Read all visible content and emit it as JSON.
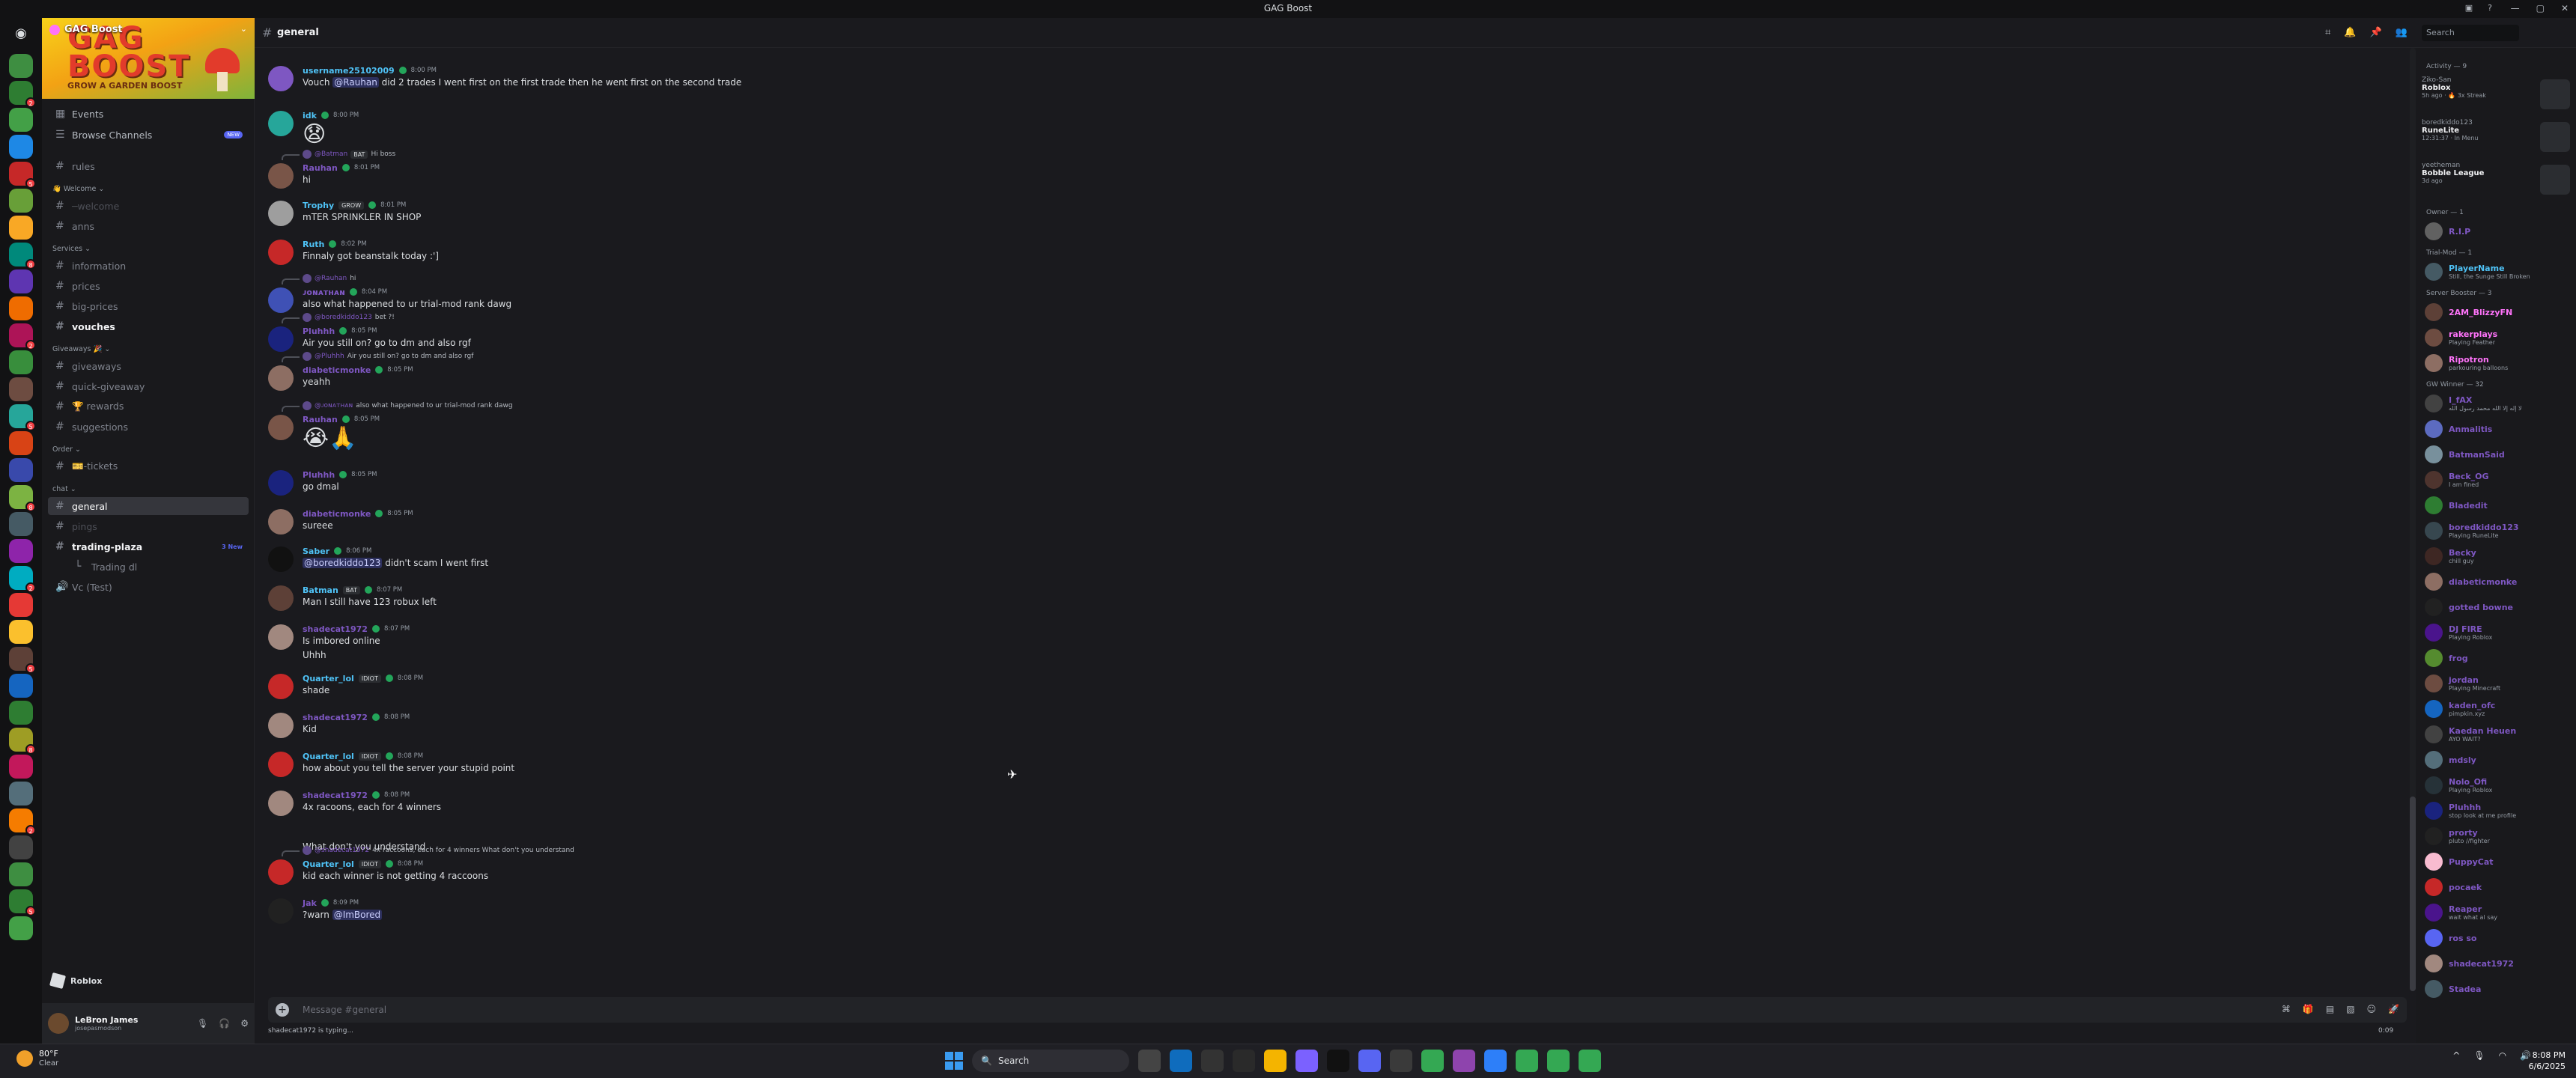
{
  "window": {
    "title": "GAG Boost"
  },
  "server": {
    "name": "GAG Boost",
    "banner_word": "GAG BOOST",
    "banner_sub": "GROW A GARDEN BOOST"
  },
  "sidebar": {
    "top_items": [
      {
        "label": "Events"
      },
      {
        "label": "Browse Channels",
        "tag": "NEW"
      }
    ],
    "rows": [
      {
        "kind": "channel",
        "label": "rules",
        "style": "normal"
      },
      {
        "kind": "category",
        "label": "👋 Welcome ⌄"
      },
      {
        "kind": "channel",
        "label": "─welcome",
        "style": "dim"
      },
      {
        "kind": "channel",
        "label": "anns",
        "style": "normal"
      },
      {
        "kind": "category",
        "label": "Services ⌄"
      },
      {
        "kind": "channel",
        "label": "information",
        "style": "normal"
      },
      {
        "kind": "channel",
        "label": "prices",
        "style": "normal"
      },
      {
        "kind": "channel",
        "label": "big-prices",
        "style": "normal"
      },
      {
        "kind": "channel",
        "label": "vouches",
        "style": "bright"
      },
      {
        "kind": "category",
        "label": "Giveaways 🎉 ⌄"
      },
      {
        "kind": "channel",
        "label": "giveaways",
        "style": "normal"
      },
      {
        "kind": "channel",
        "label": "quick-giveaway",
        "style": "normal"
      },
      {
        "kind": "channel",
        "label": "🏆 rewards",
        "style": "normal"
      },
      {
        "kind": "channel",
        "label": "suggestions",
        "style": "normal"
      },
      {
        "kind": "category",
        "label": "Order ⌄"
      },
      {
        "kind": "channel",
        "label": "🎫-tickets",
        "style": "normal"
      },
      {
        "kind": "category",
        "label": "chat ⌄"
      },
      {
        "kind": "channel",
        "label": "general",
        "style": "active"
      },
      {
        "kind": "channel",
        "label": "pings",
        "style": "dim"
      },
      {
        "kind": "channel",
        "label": "trading-plaza",
        "style": "bright",
        "extra": "3 New"
      },
      {
        "kind": "thread",
        "label": "Trading dl",
        "style": "normal"
      },
      {
        "kind": "voice",
        "label": "Vc (Test)",
        "style": "normal"
      }
    ]
  },
  "activity_bar": {
    "label": "Roblox"
  },
  "user": {
    "name": "LeBron James",
    "status": "josepasmodson"
  },
  "header": {
    "channel": "general",
    "search_placeholder": "Search"
  },
  "messages": [
    {
      "user": "username25102009",
      "color": "#4fc3f7",
      "time": "8:00 PM",
      "text_pre": "Vouch ",
      "mention": "@Rauhan",
      "text_post": " did 2 trades I went first on the first trade then he went first on the second trade",
      "avatar": "#7e57c2"
    },
    {
      "user": "idk",
      "color": "#4fc3f7",
      "time": "8:00 PM",
      "emoji": "😧",
      "avatar": "#26a69a"
    },
    {
      "user": "Rauhan",
      "color": "#7e57c2",
      "time": "8:01 PM",
      "text_pre": "hi",
      "reply_name": "@Batman",
      "reply_tag": "BAT",
      "reply_text": "Hi boss",
      "avatar": "#795548"
    },
    {
      "user": "Trophy",
      "color": "#4fc3f7",
      "tag": "GROW",
      "time": "8:01 PM",
      "text_pre": "mTER SPRINKLER IN SHOP",
      "avatar": "#9e9e9e"
    },
    {
      "user": "Ruth",
      "color": "#4fc3f7",
      "time": "8:02 PM",
      "text_pre": "Finnaly got beanstalk today :']",
      "avatar": "#c62828"
    },
    {
      "user": "ᴊᴏɴᴀᴛʜᴀɴ",
      "color": "#7e57c2",
      "time": "8:04 PM",
      "text_pre": "also what happened to ur trial-mod rank dawg",
      "reply_name": "@Rauhan",
      "reply_text": "hi",
      "avatar": "#3f51b5"
    },
    {
      "user": "Pluhhh",
      "color": "#7e57c2",
      "time": "8:05 PM",
      "text_pre": "Air you still on? go to dm and also rgf",
      "reply_name": "@boredkiddo123",
      "reply_text": "bet ?!",
      "avatar": "#1a237e"
    },
    {
      "user": "diabeticmonke",
      "color": "#7e57c2",
      "time": "8:05 PM",
      "text_pre": "yeahh",
      "reply_name": "@Pluhhh",
      "reply_text": "Air you still on? go to dm and also rgf",
      "avatar": "#8d6e63"
    },
    {
      "user": "Rauhan",
      "color": "#7e57c2",
      "time": "8:05 PM",
      "emoji": "😭🙏",
      "reply_name": "@ᴊᴏɴᴀᴛʜᴀɴ",
      "reply_text": "also what happened to ur trial-mod rank dawg",
      "avatar": "#795548"
    },
    {
      "user": "Pluhhh",
      "color": "#7e57c2",
      "time": "8:05 PM",
      "text_pre": "go dmal",
      "avatar": "#1a237e"
    },
    {
      "user": "diabeticmonke",
      "color": "#7e57c2",
      "time": "8:05 PM",
      "text_pre": "sureee",
      "avatar": "#8d6e63"
    },
    {
      "user": "Saber",
      "color": "#4fc3f7",
      "time": "8:06 PM",
      "mention_first": "@boredkiddo123",
      "text_post": " didn't scam I went first",
      "avatar": "#111111"
    },
    {
      "user": "Batman",
      "color": "#4fc3f7",
      "tag": "BAT",
      "time": "8:07 PM",
      "text_pre": "Man I still have 123 robux left",
      "avatar": "#5d4037"
    },
    {
      "user": "shadecat1972",
      "color": "#7e57c2",
      "time": "8:07 PM",
      "text_pre": "Is imbored online",
      "text_line2": "Uhhh",
      "avatar": "#a1887f"
    },
    {
      "user": "Quarter_lol",
      "color": "#4fc3f7",
      "tag": "IDIOT",
      "time": "8:08 PM",
      "text_pre": "shade",
      "avatar": "#c62828"
    },
    {
      "user": "shadecat1972",
      "color": "#7e57c2",
      "time": "8:08 PM",
      "text_pre": "Kid",
      "avatar": "#a1887f"
    },
    {
      "user": "Quarter_lol",
      "color": "#4fc3f7",
      "tag": "IDIOT",
      "time": "8:08 PM",
      "text_pre": "how about you tell the server your stupid point",
      "avatar": "#c62828"
    },
    {
      "user": "shadecat1972",
      "color": "#7e57c2",
      "time": "8:08 PM",
      "text_pre": "4x racoons, each for 4 winners",
      "text_line3": "What don't you understand",
      "avatar": "#a1887f"
    },
    {
      "user": "Quarter_lol",
      "color": "#4fc3f7",
      "tag": "IDIOT",
      "time": "8:08 PM",
      "text_pre": "kid each winner is not getting 4 raccoons",
      "reply_name": "@shadecat1972",
      "reply_text": "4x raccoons, each for 4 winners  What don't you understand",
      "avatar": "#c62828"
    },
    {
      "user": "Jak",
      "color": "#7e57c2",
      "time": "8:09 PM",
      "text_pre": "?warn ",
      "mention": "@ImBored",
      "avatar": "#212121"
    }
  ],
  "composer": {
    "placeholder": "Message #general",
    "typing": "shadecat1972 is typing...",
    "slowmode": "0:09"
  },
  "members": {
    "activity_header": "Activity — 9",
    "activity": [
      {
        "name": "Ziko-San",
        "game": "Roblox",
        "time": "5h ago · 🔥 3x Streak"
      },
      {
        "name": "boredkiddo123",
        "game": "RuneLite",
        "time": "12:31:37 · In Menu"
      },
      {
        "name": "yeetheman",
        "game": "Bobble League",
        "time": "3d ago"
      }
    ],
    "sections": [
      {
        "title": "Owner — 1",
        "items": [
          {
            "name": "R.I.P",
            "status": "",
            "color": "#7e57c2",
            "av": "#616161"
          }
        ]
      },
      {
        "title": "Trial-Mod — 1",
        "items": [
          {
            "name": "PlayerName",
            "status": "Still, the Sunge Still Broken",
            "color": "#4fc3f7",
            "av": "#455a64"
          }
        ]
      },
      {
        "title": "Server Booster — 3",
        "items": [
          {
            "name": "2AM_BlizzyFN",
            "status": "",
            "color": "#ff73fa",
            "av": "#5d4037"
          },
          {
            "name": "rakerplays",
            "status": "Playing Feather",
            "color": "#ff73fa",
            "av": "#6d4c41"
          },
          {
            "name": "Ripotron",
            "status": "parkouring balloons",
            "color": "#ff73fa",
            "av": "#8d6e63"
          }
        ]
      },
      {
        "title": "GW Winner — 32",
        "items": [
          {
            "name": "I_fAX",
            "status": "لا إله إلا الله محمد رسول الله",
            "color": "#7e57c2",
            "av": "#424242"
          },
          {
            "name": "Anmalitis",
            "status": "",
            "color": "#7e57c2",
            "av": "#5c6bc0"
          },
          {
            "name": "BatmanSaid",
            "status": "",
            "color": "#7e57c2",
            "av": "#78909c"
          },
          {
            "name": "Beck_OG",
            "status": "I am fined",
            "color": "#7e57c2",
            "av": "#4e342e"
          },
          {
            "name": "Bladedit",
            "status": "",
            "color": "#7e57c2",
            "av": "#2e7d32"
          },
          {
            "name": "boredkiddo123",
            "status": "Playing RuneLite",
            "color": "#7e57c2",
            "av": "#37474f"
          },
          {
            "name": "Becky",
            "status": "chill guy",
            "color": "#7e57c2",
            "av": "#3e2723"
          },
          {
            "name": "diabeticmonke",
            "status": "",
            "color": "#7e57c2",
            "av": "#8d6e63"
          },
          {
            "name": "gotted bowne",
            "status": "",
            "color": "#7e57c2",
            "av": "#212121"
          },
          {
            "name": "DJ FIRE",
            "status": "Playing Roblox",
            "color": "#7e57c2",
            "av": "#4a148c"
          },
          {
            "name": "frog",
            "status": "",
            "color": "#7e57c2",
            "av": "#558b2f"
          },
          {
            "name": "jordan",
            "status": "Playing Minecraft",
            "color": "#7e57c2",
            "av": "#6d4c41"
          },
          {
            "name": "kaden_ofc",
            "status": "pimpkin.xyz",
            "color": "#7e57c2",
            "av": "#1565c0"
          },
          {
            "name": "Kaedan Heuen",
            "status": "AYO WAIT?",
            "color": "#7e57c2",
            "av": "#424242"
          },
          {
            "name": "mdsly",
            "status": "",
            "color": "#7e57c2",
            "av": "#546e7a"
          },
          {
            "name": "Nolo_Ofi",
            "status": "Playing Roblox",
            "color": "#7e57c2",
            "av": "#263238"
          },
          {
            "name": "Pluhhh",
            "status": "stop look at me profile",
            "color": "#7e57c2",
            "av": "#1a237e"
          },
          {
            "name": "prorty",
            "status": "pluto //fighter",
            "color": "#7e57c2",
            "av": "#212121"
          },
          {
            "name": "PuppyCat",
            "status": "",
            "color": "#7e57c2",
            "av": "#f8bbd0"
          },
          {
            "name": "pocaek",
            "status": "",
            "color": "#7e57c2",
            "av": "#c62828"
          },
          {
            "name": "Reaper",
            "status": "wait what al say",
            "color": "#7e57c2",
            "av": "#4a148c"
          },
          {
            "name": "ros so",
            "status": "",
            "color": "#7e57c2",
            "av": "#5865f2"
          },
          {
            "name": "shadecat1972",
            "status": "",
            "color": "#7e57c2",
            "av": "#a1887f"
          },
          {
            "name": "Stadea",
            "status": "",
            "color": "#7e57c2",
            "av": "#455a64"
          }
        ]
      }
    ]
  },
  "taskbar": {
    "weather_temp": "80°F",
    "weather_desc": "Clear",
    "search": "Search",
    "time": "8:08 PM",
    "date": "6/6/2025"
  }
}
